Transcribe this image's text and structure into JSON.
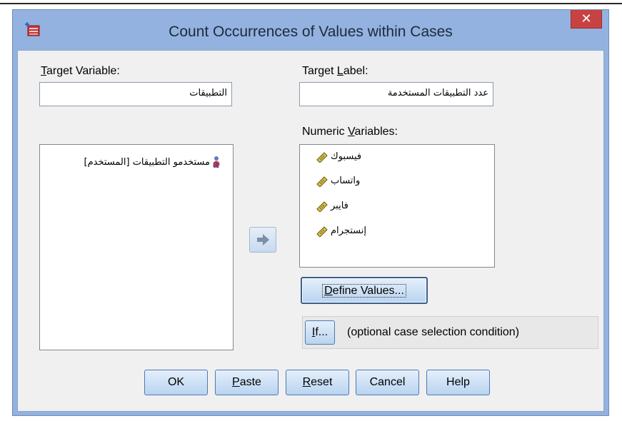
{
  "window": {
    "title": "Count Occurrences of Values within Cases",
    "close_glyph": "✕",
    "icon": "spss-compute-icon"
  },
  "target_variable": {
    "label_underlined": "T",
    "label_rest": "arget Variable:",
    "value": "التطبيقات"
  },
  "target_label": {
    "label_pre": "Target ",
    "label_underlined": "L",
    "label_post": "abel:",
    "value": "عدد التطبيقات المستخدمة"
  },
  "source_list": {
    "items": [
      {
        "label": "مستخدمو التطبيقات [المستخدم]",
        "icon": "nominal-string-variable-icon"
      }
    ]
  },
  "move_button": {
    "icon": "right-arrow-icon"
  },
  "numeric_variables": {
    "label_pre": "Numeric ",
    "label_underlined": "V",
    "label_post": "ariables:",
    "items": [
      {
        "label": "فيسبوك",
        "icon": "scale-ruler-icon"
      },
      {
        "label": "واتساب",
        "icon": "scale-ruler-icon"
      },
      {
        "label": "فايبر",
        "icon": "scale-ruler-icon"
      },
      {
        "label": "إنستجرام",
        "icon": "scale-ruler-icon"
      }
    ]
  },
  "define_values_button": {
    "underlined": "D",
    "rest": "efine Values..."
  },
  "if_button": {
    "underlined": "I",
    "rest": "f..."
  },
  "if_caption": "(optional case selection condition)",
  "buttons": {
    "ok": "OK",
    "paste_underlined": "P",
    "paste_rest": "aste",
    "reset_underlined": "R",
    "reset_rest": "eset",
    "cancel": "Cancel",
    "help": "Help"
  },
  "colors": {
    "frame": "#93b2df",
    "close": "#c74343",
    "button_border": "#4f7ab0",
    "client": "#f0f0f0"
  }
}
